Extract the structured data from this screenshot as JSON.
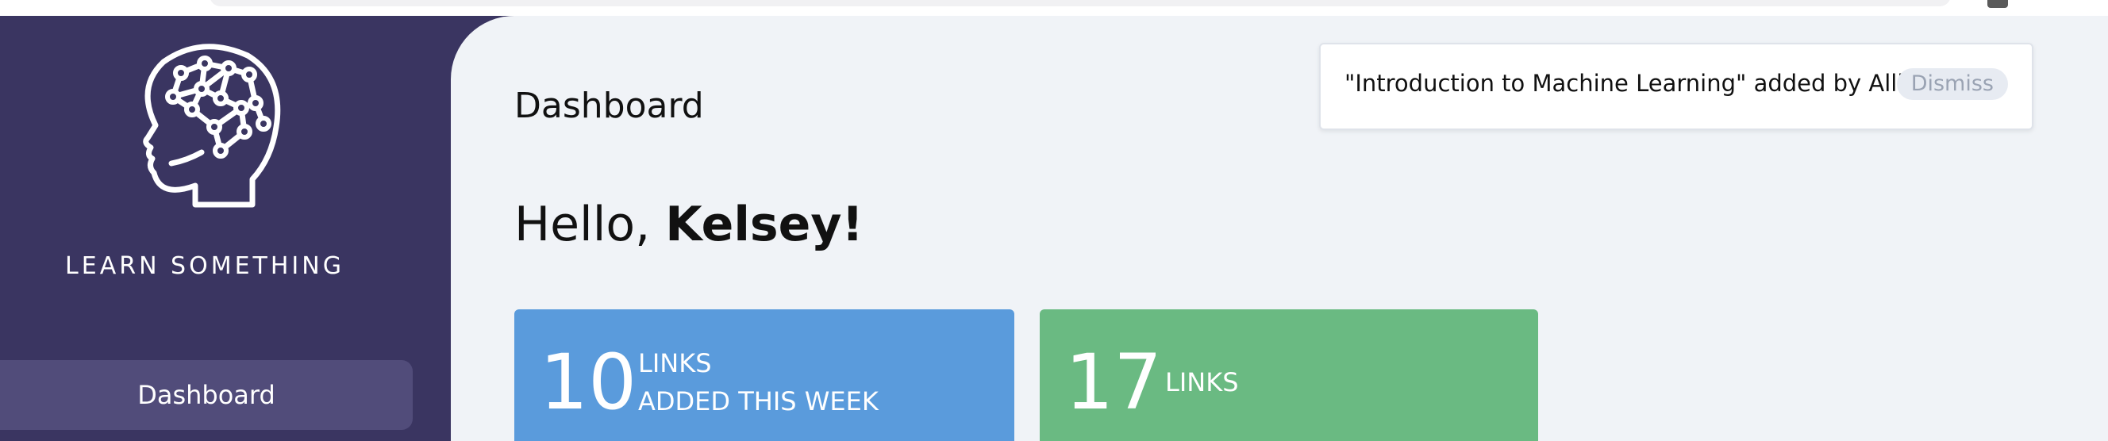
{
  "brand": {
    "name": "LEARN SOMETHING",
    "logo_icon": "brain-head-icon"
  },
  "sidebar": {
    "items": [
      {
        "label": "Dashboard",
        "active": true
      }
    ]
  },
  "main": {
    "title": "Dashboard",
    "greeting_prefix": "Hello, ",
    "user_name": "Kelsey!",
    "stats": [
      {
        "value": "10",
        "label_line1": "LINKS",
        "label_line2": "ADDED THIS WEEK",
        "color": "#5a9bdc"
      },
      {
        "value": "17",
        "label_line1": "LINKS",
        "color": "#6aba82"
      }
    ]
  },
  "notification": {
    "message": "\"Introduction to Machine Learning\" added by Allison",
    "dismiss_label": "Dismiss"
  },
  "colors": {
    "sidebar_bg": "#3a3561",
    "nav_active_bg": "#514c7a",
    "main_bg": "#f0f3f7"
  }
}
